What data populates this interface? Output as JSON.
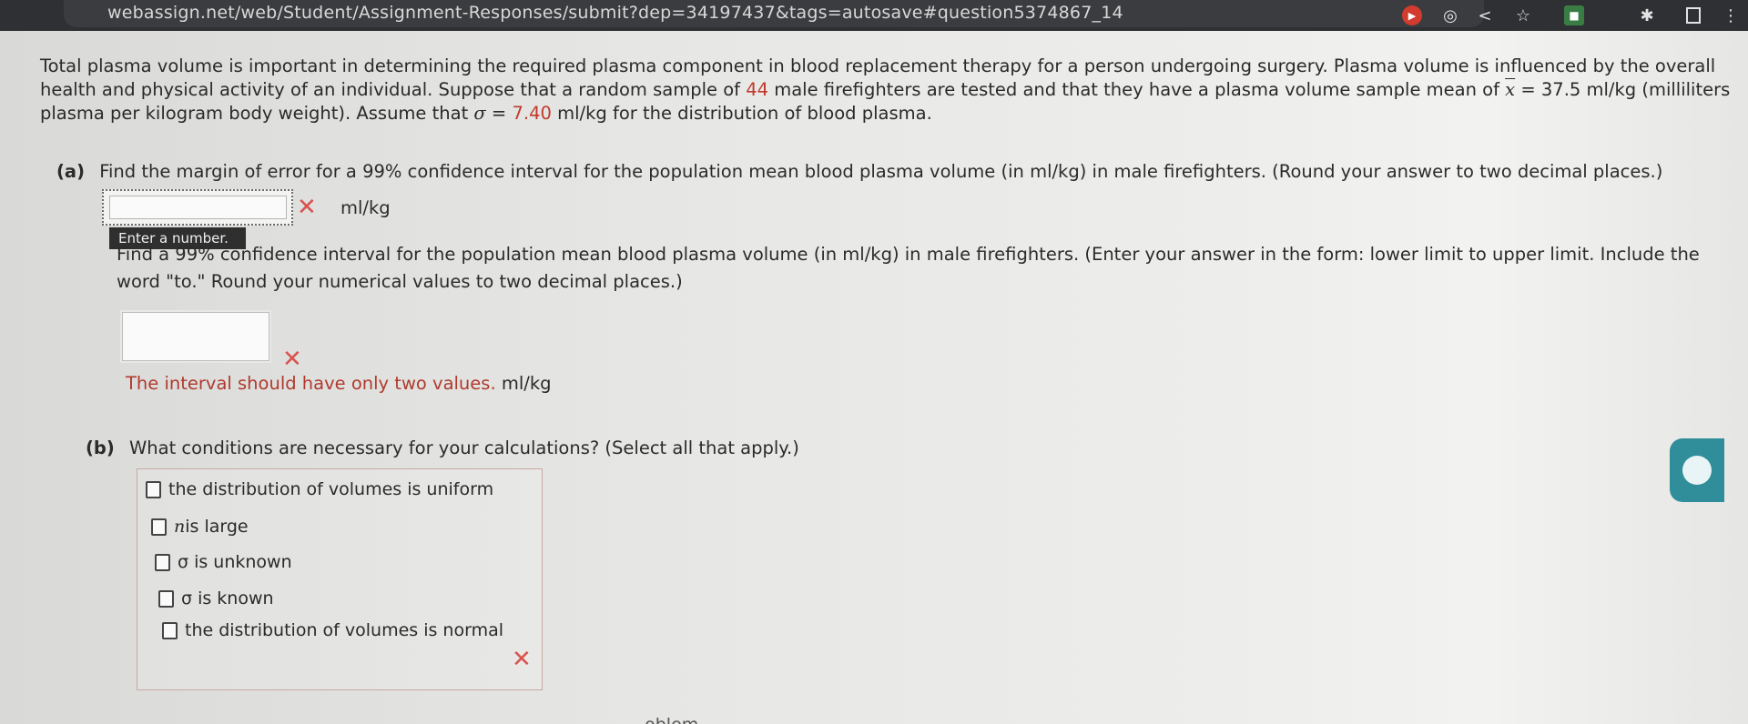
{
  "browser": {
    "url": "webassign.net/web/Student/Assignment-Responses/submit?dep=34197437&tags=autosave#question5374867_14"
  },
  "problem": {
    "intro_1": "Total plasma volume is important in determining the required plasma component in blood replacement therapy for a person undergoing surgery. Plasma volume is influenced by the overall health and physical activity of an individual. Suppose that a random sample of ",
    "n_value": "44",
    "intro_2": " male firefighters are tested and that they have a plasma volume sample mean of ",
    "xbar_sym": "x",
    "xbar_eq": " = 37.5 ml/kg",
    "intro_3": " (milliliters plasma per kilogram body weight). Assume that ",
    "sigma_sym": "σ",
    "sigma_eq": " = ",
    "sigma_value": "7.40",
    "intro_4": " ml/kg for the distribution of blood plasma."
  },
  "part_a": {
    "label": "(a)",
    "question": "Find the margin of error for a 99% confidence interval for the population mean blood plasma volume (in ml/kg) in male firefighters. (Round your answer to two decimal places.)",
    "unit": "ml/kg",
    "tooltip": "Enter a number.",
    "question_interval": "Find a 99% confidence interval for the population mean blood plasma volume (in ml/kg) in male firefighters. (Enter your answer in the form: lower limit to upper limit. Include the word \"to.\" Round your numerical values to two decimal places.)",
    "error_msg": "The interval should have only two values.",
    "error_unit": "ml/kg"
  },
  "part_b": {
    "label": "(b)",
    "question": "What conditions are necessary for your calculations? (Select all that apply.)",
    "options": [
      {
        "italic_prefix": "",
        "text": "the distribution of volumes is uniform"
      },
      {
        "italic_prefix": "n",
        "text": " is large"
      },
      {
        "italic_prefix": "",
        "text": "σ is unknown"
      },
      {
        "italic_prefix": "",
        "text": "σ is known"
      },
      {
        "italic_prefix": "",
        "text": "the distribution of volumes is normal"
      }
    ]
  },
  "footer": {
    "partial": "...oblem"
  },
  "colors": {
    "accent_red": "#c0392b",
    "x_mark": "#d9534f",
    "side_button": "#2f8e9a"
  }
}
